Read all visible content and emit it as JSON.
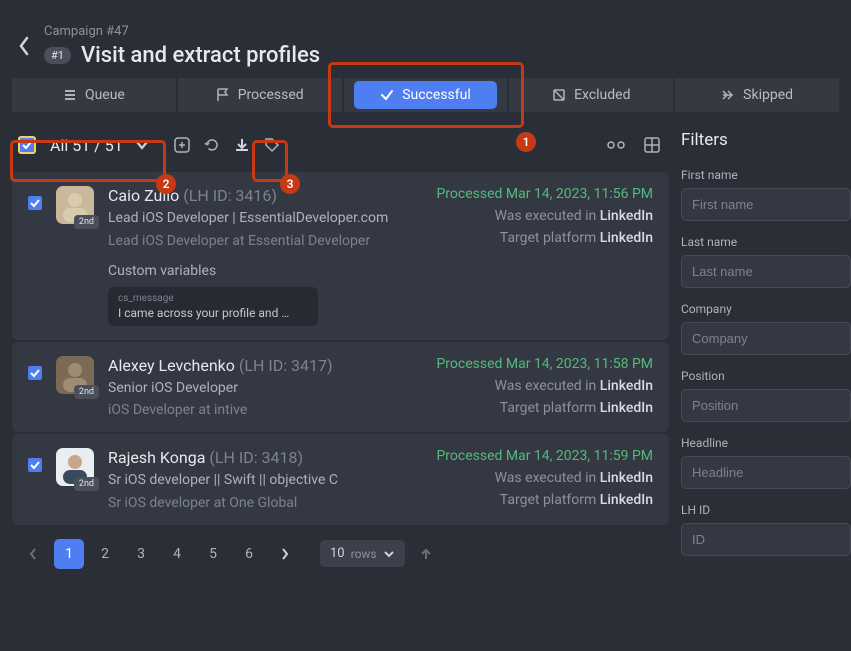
{
  "header": {
    "campaign_label": "Campaign #47",
    "badge": "#1",
    "title": "Visit and extract profiles"
  },
  "tabs": {
    "queue": "Queue",
    "processed": "Processed",
    "successful": "Successful",
    "excluded": "Excluded",
    "skipped": "Skipped"
  },
  "toolbar": {
    "selection_label": "All 51 / 51"
  },
  "annotations": {
    "a1": "1",
    "a2": "2",
    "a3": "3"
  },
  "records": [
    {
      "name": "Caio Zullo",
      "lhid": "(LH ID: 3416)",
      "subtitle": "Lead iOS Developer | EssentialDeveloper.com",
      "subtitle2": "Lead iOS Developer at Essential Developer",
      "degree": "2nd",
      "processed": "Processed Mar 14, 2023, 11:56 PM",
      "executed_label": "Was executed in ",
      "executed_val": "LinkedIn",
      "target_label": "Target platform ",
      "target_val": "LinkedIn",
      "custom_header": "Custom variables",
      "var_key": "cs_message",
      "var_val": "I came across your profile and …"
    },
    {
      "name": "Alexey Levchenko",
      "lhid": "(LH ID: 3417)",
      "subtitle": "Senior iOS Developer",
      "subtitle2": "iOS Developer at intive",
      "degree": "2nd",
      "processed": "Processed Mar 14, 2023, 11:58 PM",
      "executed_label": "Was executed in ",
      "executed_val": "LinkedIn",
      "target_label": "Target platform ",
      "target_val": "LinkedIn"
    },
    {
      "name": "Rajesh Konga",
      "lhid": "(LH ID: 3418)",
      "subtitle": "Sr iOS developer || Swift || objective C",
      "subtitle2": "Sr iOS developer at One Global",
      "degree": "2nd",
      "processed": "Processed Mar 14, 2023, 11:59 PM",
      "executed_label": "Was executed in ",
      "executed_val": "LinkedIn",
      "target_label": "Target platform ",
      "target_val": "LinkedIn"
    }
  ],
  "pager": {
    "pages": [
      "1",
      "2",
      "3",
      "4",
      "5",
      "6"
    ],
    "rows_count": "10",
    "rows_label": "rows"
  },
  "filters": {
    "title": "Filters",
    "first_name": {
      "label": "First name",
      "placeholder": "First name"
    },
    "last_name": {
      "label": "Last name",
      "placeholder": "Last name"
    },
    "company": {
      "label": "Company",
      "placeholder": "Company"
    },
    "position": {
      "label": "Position",
      "placeholder": "Position"
    },
    "headline": {
      "label": "Headline",
      "placeholder": "Headline"
    },
    "lh_id": {
      "label": "LH ID",
      "placeholder": "ID"
    }
  }
}
